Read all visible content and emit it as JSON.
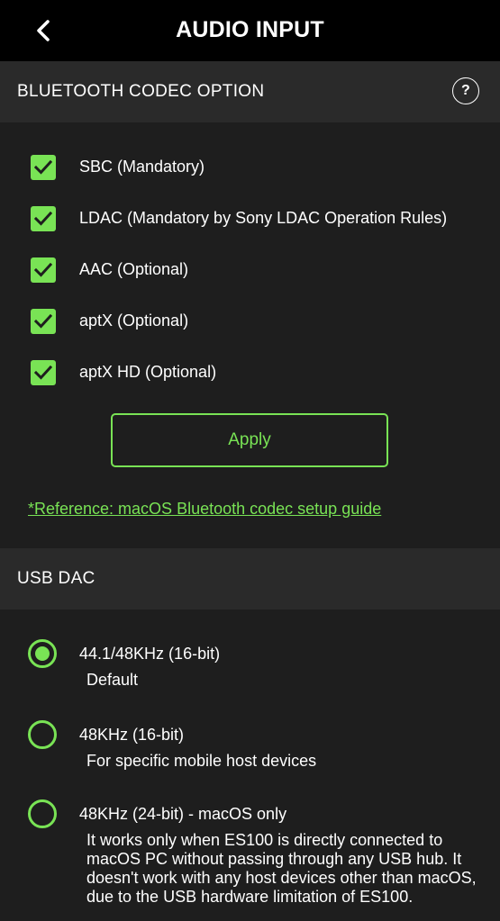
{
  "header": {
    "title": "AUDIO INPUT",
    "back_icon": "chevron-left-icon"
  },
  "bluetooth": {
    "section_title": "BLUETOOTH CODEC OPTION",
    "help_label": "?",
    "codecs": [
      {
        "label": "SBC (Mandatory)",
        "checked": true
      },
      {
        "label": "LDAC (Mandatory by Sony LDAC Operation Rules)",
        "checked": true
      },
      {
        "label": "AAC (Optional)",
        "checked": true
      },
      {
        "label": "aptX (Optional)",
        "checked": true
      },
      {
        "label": "aptX HD (Optional)",
        "checked": true
      }
    ],
    "apply_label": "Apply",
    "reference_link": "*Reference: macOS Bluetooth codec setup guide"
  },
  "usb": {
    "section_title": "USB DAC",
    "options": [
      {
        "title": "44.1/48KHz (16-bit)",
        "description": "Default",
        "selected": true
      },
      {
        "title": "48KHz (16-bit)",
        "description": "For specific mobile host devices",
        "selected": false
      },
      {
        "title": "48KHz (24-bit) - macOS only",
        "description": "It works only when ES100 is directly connected to macOS PC without passing through any USB hub. It doesn't work with any host devices other than macOS, due to the USB hardware limitation of ES100.",
        "selected": false
      }
    ]
  },
  "colors": {
    "accent": "#79e355",
    "background": "#1e1e1e",
    "header_bg": "#000000",
    "section_bg": "#2a2a2a"
  }
}
